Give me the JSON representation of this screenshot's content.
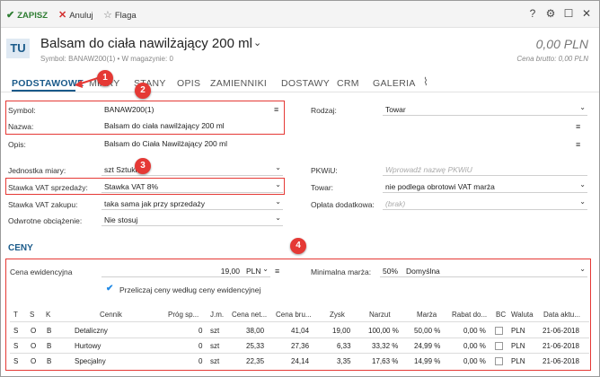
{
  "toolbar": {
    "save_label": "ZAPISZ",
    "cancel_label": "Anuluj",
    "flag_label": "Flaga",
    "help": "?",
    "settings": "⚙",
    "maximize": "☐",
    "close": "✕"
  },
  "header": {
    "avatar": "TU",
    "title": "Balsam do ciała nawilżający 200 ml",
    "title_chevron": "⌄",
    "subtitle": "Symbol: BANAW200(1)  •  W magazynie: 0",
    "price": "0,00 PLN",
    "price_sub": "Cena brutto: 0,00 PLN"
  },
  "tabs": [
    "PODSTAWOWE",
    "MIARY",
    "STANY",
    "OPIS",
    "ZAMIENNIKI",
    "DOSTAWY",
    "CRM",
    "GALERIA"
  ],
  "form": {
    "symbol_label": "Symbol:",
    "symbol_value": "BANAW200(1)",
    "nazwa_label": "Nazwa:",
    "nazwa_value": "Balsam do ciała nawilżający 200 ml",
    "opis_label": "Opis:",
    "opis_value": "Balsam do Ciała Nawilżający 200 ml",
    "jm_label": "Jednostka miary:",
    "jm_value": "szt  Sztuki",
    "vat_sale_label": "Stawka VAT sprzedaży:",
    "vat_sale_value": "Stawka VAT 8%",
    "vat_buy_label": "Stawka VAT zakupu:",
    "vat_buy_value": "taka sama jak przy sprzedaży",
    "reverse_label": "Odwrotne obciążenie:",
    "reverse_value": "Nie stosuj",
    "rodzaj_label": "Rodzaj:",
    "rodzaj_value": "Towar",
    "pkwiu_label": "PKWiU:",
    "pkwiu_placeholder": "Wprowadź nazwę PKWiU",
    "towar_label": "Towar:",
    "towar_value": "nie podlega obrotowi VAT marża",
    "oplata_label": "Opłata dodatkowa:",
    "oplata_placeholder": "(brak)"
  },
  "ceny": {
    "section_title": "CENY",
    "cena_ewid_label": "Cena ewidencyjna",
    "cena_ewid_value": "19,00",
    "currency": "PLN",
    "min_margin_label": "Minimalna marża:",
    "min_margin_value": "50%",
    "min_margin_mode": "Domyślna",
    "recalc_label": "Przeliczaj ceny według ceny ewidencyjnej"
  },
  "annotations": [
    "1",
    "2",
    "3",
    "4"
  ],
  "price_table": {
    "headers": [
      "T",
      "S",
      "K",
      "Cennik",
      "Próg sp...",
      "J.m.",
      "Cena net...",
      "Cena bru...",
      "Zysk",
      "Narzut",
      "Marża",
      "Rabat do...",
      "BC",
      "Waluta",
      "Data aktu..."
    ],
    "rows": [
      {
        "t": "S",
        "s": "O",
        "k": "B",
        "cennik": "Detaliczny",
        "prog": "0",
        "jm": "szt",
        "netto": "38,00",
        "brutto": "41,04",
        "zysk": "19,00",
        "narzut": "100,00 %",
        "marza": "50,00 %",
        "rabat": "0,00 %",
        "waluta": "PLN",
        "data": "21-06-2018"
      },
      {
        "t": "S",
        "s": "O",
        "k": "B",
        "cennik": "Hurtowy",
        "prog": "0",
        "jm": "szt",
        "netto": "25,33",
        "brutto": "27,36",
        "zysk": "6,33",
        "narzut": "33,32 %",
        "marza": "24,99 %",
        "rabat": "0,00 %",
        "waluta": "PLN",
        "data": "21-06-2018"
      },
      {
        "t": "S",
        "s": "O",
        "k": "B",
        "cennik": "Specjalny",
        "prog": "0",
        "jm": "szt",
        "netto": "22,35",
        "brutto": "24,14",
        "zysk": "3,35",
        "narzut": "17,63 %",
        "marza": "14,99 %",
        "rabat": "0,00 %",
        "waluta": "PLN",
        "data": "21-06-2018"
      }
    ]
  }
}
